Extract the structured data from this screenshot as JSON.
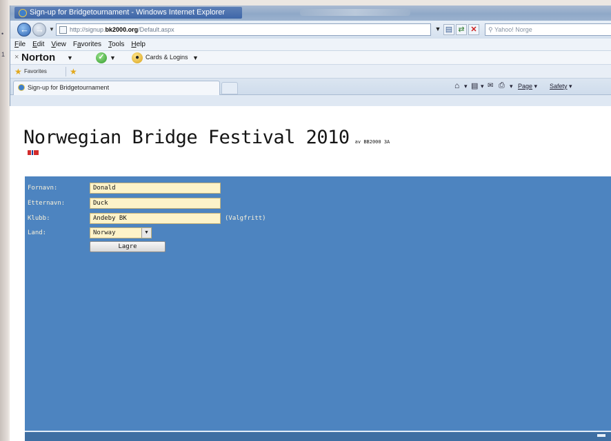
{
  "window": {
    "title": "Sign-up for Bridgetournament - Windows Internet Explorer"
  },
  "address_bar": {
    "url_prefix": "http://signup.",
    "url_host": "bk2000.org",
    "url_path": "/Default.aspx",
    "search_placeholder": "Yahoo! Norge"
  },
  "menu": {
    "items": [
      {
        "accel": "F",
        "rest": "ile"
      },
      {
        "accel": "E",
        "rest": "dit"
      },
      {
        "accel": "V",
        "rest": "iew"
      },
      {
        "pre": "F",
        "accel": "a",
        "rest": "vorites"
      },
      {
        "accel": "T",
        "rest": "ools"
      },
      {
        "accel": "H",
        "rest": "elp"
      }
    ]
  },
  "norton": {
    "label": "Norton",
    "cards_label": "Cards & Logins"
  },
  "favorites": {
    "label": "Favorites"
  },
  "tab": {
    "title": "Sign-up for Bridgetournament"
  },
  "command_bar": {
    "page_label": "Page",
    "safety_label": "Safety"
  },
  "page": {
    "heading": "Norwegian Bridge Festival 2010",
    "subtitle": "av BB2000 3A"
  },
  "form": {
    "fornavn_label": "Fornavn:",
    "fornavn_value": "Donald",
    "etternavn_label": "Etternavn:",
    "etternavn_value": "Duck",
    "klubb_label": "Klubb:",
    "klubb_value": "Andeby BK",
    "klubb_hint": "(Valgfritt)",
    "land_label": "Land:",
    "land_value": "Norway",
    "submit_label": "Lagre"
  },
  "colors": {
    "form_panel": "#4d84c0",
    "input_bg": "#fdf3c9",
    "label_text": "#fbf2d9"
  },
  "icons": [
    "ie-icon",
    "back-icon",
    "forward-icon",
    "refresh-icon",
    "stop-icon",
    "search-icon",
    "check-icon",
    "cards-icon",
    "star-icon",
    "home-icon",
    "feeds-icon",
    "mail-icon",
    "print-icon",
    "flag-icon"
  ]
}
